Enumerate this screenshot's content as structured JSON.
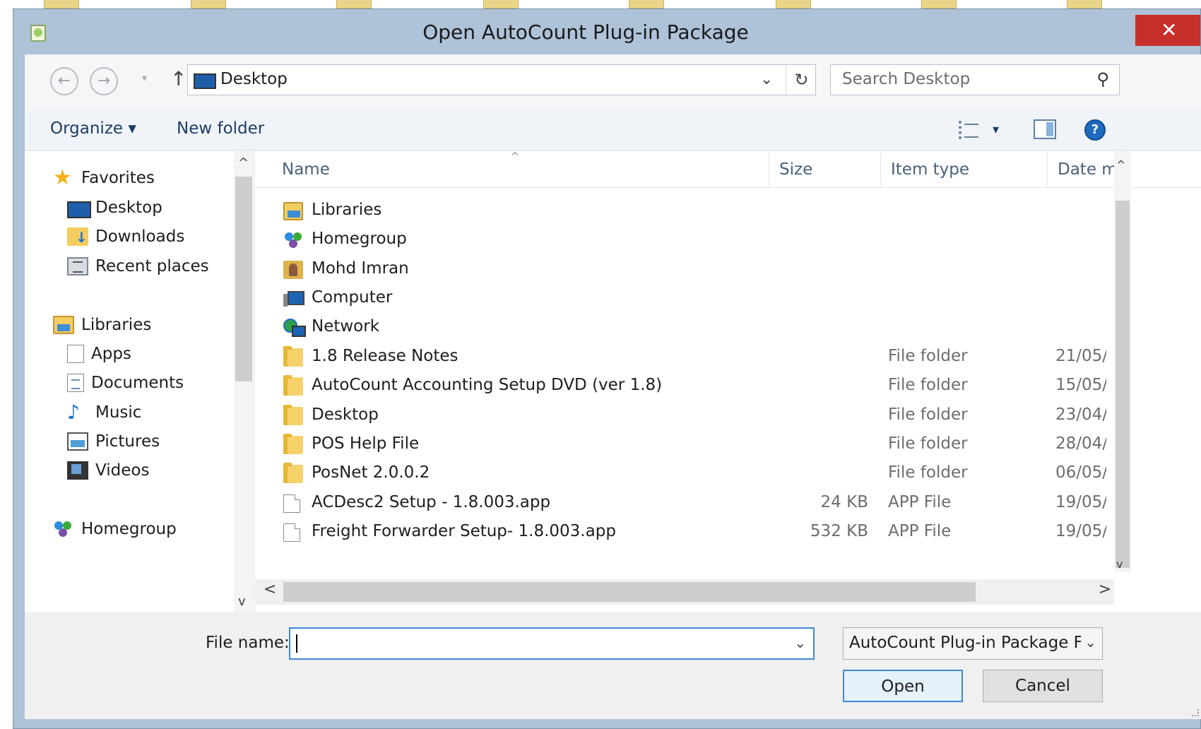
{
  "dialog": {
    "title": "Open AutoCount Plug-in Package",
    "close_glyph": "✕"
  },
  "address": {
    "back_glyph": "←",
    "forward_glyph": "→",
    "recent_glyph": "▾",
    "up_glyph": "↑",
    "path": "Desktop",
    "dropdown_glyph": "⌄",
    "refresh_glyph": "↻"
  },
  "search": {
    "placeholder": "Search Desktop",
    "icon": "⚲"
  },
  "toolbar": {
    "organize_label": "Organize ▾",
    "new_folder_label": "New folder",
    "views_dropdown_glyph": "▾",
    "help_glyph": "?"
  },
  "nav": {
    "favorites_label": "Favorites",
    "favorites": [
      "Desktop",
      "Downloads",
      "Recent places"
    ],
    "libraries_label": "Libraries",
    "libraries": [
      "Apps",
      "Documents",
      "Music",
      "Pictures",
      "Videos"
    ],
    "homegroup_label": "Homegroup",
    "scroll_up": "^",
    "scroll_down": "v"
  },
  "columns": {
    "name": "Name",
    "size": "Size",
    "item_type": "Item type",
    "date": "Date m",
    "sort_glyph": "^"
  },
  "files": [
    {
      "name": "Libraries",
      "size": "",
      "type": "",
      "date": "",
      "icon": "libraries-icon"
    },
    {
      "name": "Homegroup",
      "size": "",
      "type": "",
      "date": "",
      "icon": "homegroup-icon"
    },
    {
      "name": "Mohd Imran",
      "size": "",
      "type": "",
      "date": "",
      "icon": "user-folder-icon"
    },
    {
      "name": "Computer",
      "size": "",
      "type": "",
      "date": "",
      "icon": "computer-icon"
    },
    {
      "name": "Network",
      "size": "",
      "type": "",
      "date": "",
      "icon": "network-icon"
    },
    {
      "name": "1.8 Release Notes",
      "size": "",
      "type": "File folder",
      "date": "21/05/",
      "icon": "folder-icon"
    },
    {
      "name": "AutoCount Accounting Setup DVD (ver 1.8)",
      "size": "",
      "type": "File folder",
      "date": "15/05/",
      "icon": "folder-icon"
    },
    {
      "name": "Desktop",
      "size": "",
      "type": "File folder",
      "date": "23/04/",
      "icon": "folder-icon"
    },
    {
      "name": "POS Help File",
      "size": "",
      "type": "File folder",
      "date": "28/04/",
      "icon": "folder-icon"
    },
    {
      "name": "PosNet 2.0.0.2",
      "size": "",
      "type": "File folder",
      "date": "06/05/",
      "icon": "folder-icon"
    },
    {
      "name": "ACDesc2 Setup - 1.8.003.app",
      "size": "24 KB",
      "type": "APP File",
      "date": "19/05/",
      "icon": "file-icon"
    },
    {
      "name": "Freight Forwarder Setup- 1.8.003.app",
      "size": "532 KB",
      "type": "APP File",
      "date": "19/05/",
      "icon": "file-icon"
    }
  ],
  "scroll": {
    "up": "^",
    "down": "v",
    "left": "<",
    "right": ">"
  },
  "bottom": {
    "file_name_label": "File name:",
    "file_name_value": "",
    "file_name_dropdown": "⌄",
    "filter_value": "AutoCount Plug-in Package Fil",
    "filter_dropdown": "⌄",
    "open_label": "Open",
    "cancel_label": "Cancel"
  },
  "colors": {
    "titlebar": "#aec2d8",
    "close_button": "#c7302a",
    "focus_border": "#3c8ad9"
  }
}
